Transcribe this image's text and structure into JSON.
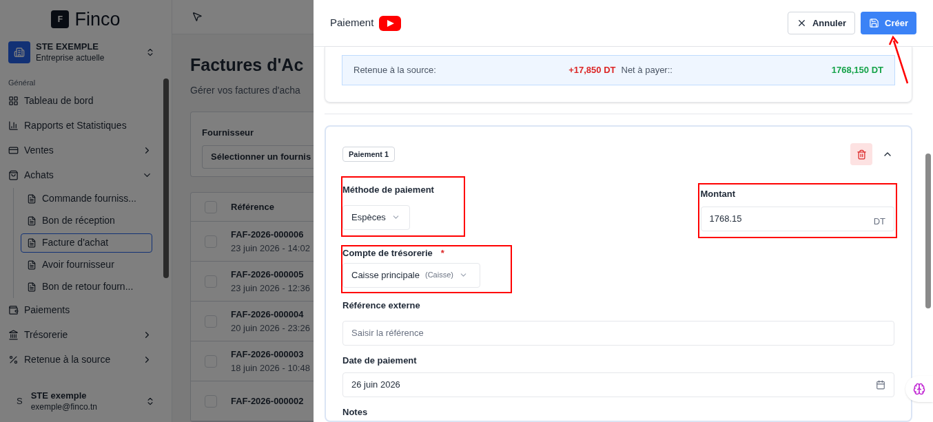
{
  "sidebar": {
    "logo": {
      "letter": "F",
      "name": "Finco"
    },
    "company": {
      "name": "STE EXEMPLE",
      "subtitle": "Entreprise actuelle"
    },
    "section": "Général",
    "items": [
      {
        "label": "Tableau de bord",
        "kind": "link"
      },
      {
        "label": "Rapports et Statistiques",
        "kind": "link"
      },
      {
        "label": "Ventes",
        "kind": "group",
        "expanded": false
      },
      {
        "label": "Achats",
        "kind": "group",
        "expanded": true,
        "children": [
          {
            "label": "Commande fourniss...",
            "selected": false
          },
          {
            "label": "Bon de réception",
            "selected": false
          },
          {
            "label": "Facture d'achat",
            "selected": true
          },
          {
            "label": "Avoir fournisseur",
            "selected": false
          },
          {
            "label": "Bon de retour fourn...",
            "selected": false
          }
        ]
      },
      {
        "label": "Paiements",
        "kind": "link"
      },
      {
        "label": "Trésorerie",
        "kind": "group",
        "expanded": false
      },
      {
        "label": "Retenue à la source",
        "kind": "group",
        "expanded": false
      }
    ],
    "user": {
      "initial": "S",
      "name": "STE exemple",
      "email": "exemple@finco.tn"
    }
  },
  "main": {
    "title": "Factures d'Ac",
    "subtitle": "Gérer vos factures d'acha",
    "filter": {
      "label": "Fournisseur",
      "value": "Sélectionner un fournis"
    },
    "table": {
      "columns": [
        "Référence"
      ],
      "all_checked": false,
      "rows": [
        {
          "reference": "FAF-2026-000006",
          "date": "23 juin 2026 - 14:02",
          "checked": false
        },
        {
          "reference": "FAF-2026-000005",
          "date": "23 juin 2026 - 12:36",
          "checked": false
        },
        {
          "reference": "FAF-2026-000004",
          "date": "20 juin 2026 - 23:26",
          "checked": false
        },
        {
          "reference": "FAF-2026-000003",
          "date": "18 juin 2026 - 10:48",
          "checked": false
        },
        {
          "reference": "FAF-2026-000002",
          "checked": false
        }
      ]
    }
  },
  "drawer": {
    "title": "Paiement",
    "buttons": [
      {
        "label": "Annuler",
        "kind": "secondary"
      },
      {
        "label": "Créer",
        "kind": "primary",
        "annotated": true
      }
    ],
    "summary": [
      {
        "label": "Retenue à la source:",
        "value": "+17,850 DT",
        "color": "#dc2626"
      },
      {
        "label": "Net à payer::",
        "value": "1768,150 DT",
        "color": "#16a34a"
      }
    ],
    "payment": {
      "badge": "Paiement 1",
      "expanded": true,
      "method": {
        "label": "Méthode de paiement",
        "value": "Espèces",
        "highlighted": true
      },
      "amount": {
        "label": "Montant",
        "value": "1768.15",
        "unit": "DT",
        "highlighted": true
      },
      "account": {
        "label": "Compte de trésorerie",
        "required_mark": "*",
        "value": "Caisse principale",
        "hint": "(Caisse)",
        "highlighted": true
      },
      "reference": {
        "label": "Référence externe",
        "placeholder": "Saisir la référence"
      },
      "date": {
        "label": "Date de paiement",
        "value": "26 juin 2026"
      },
      "notes": {
        "label": "Notes"
      }
    }
  }
}
